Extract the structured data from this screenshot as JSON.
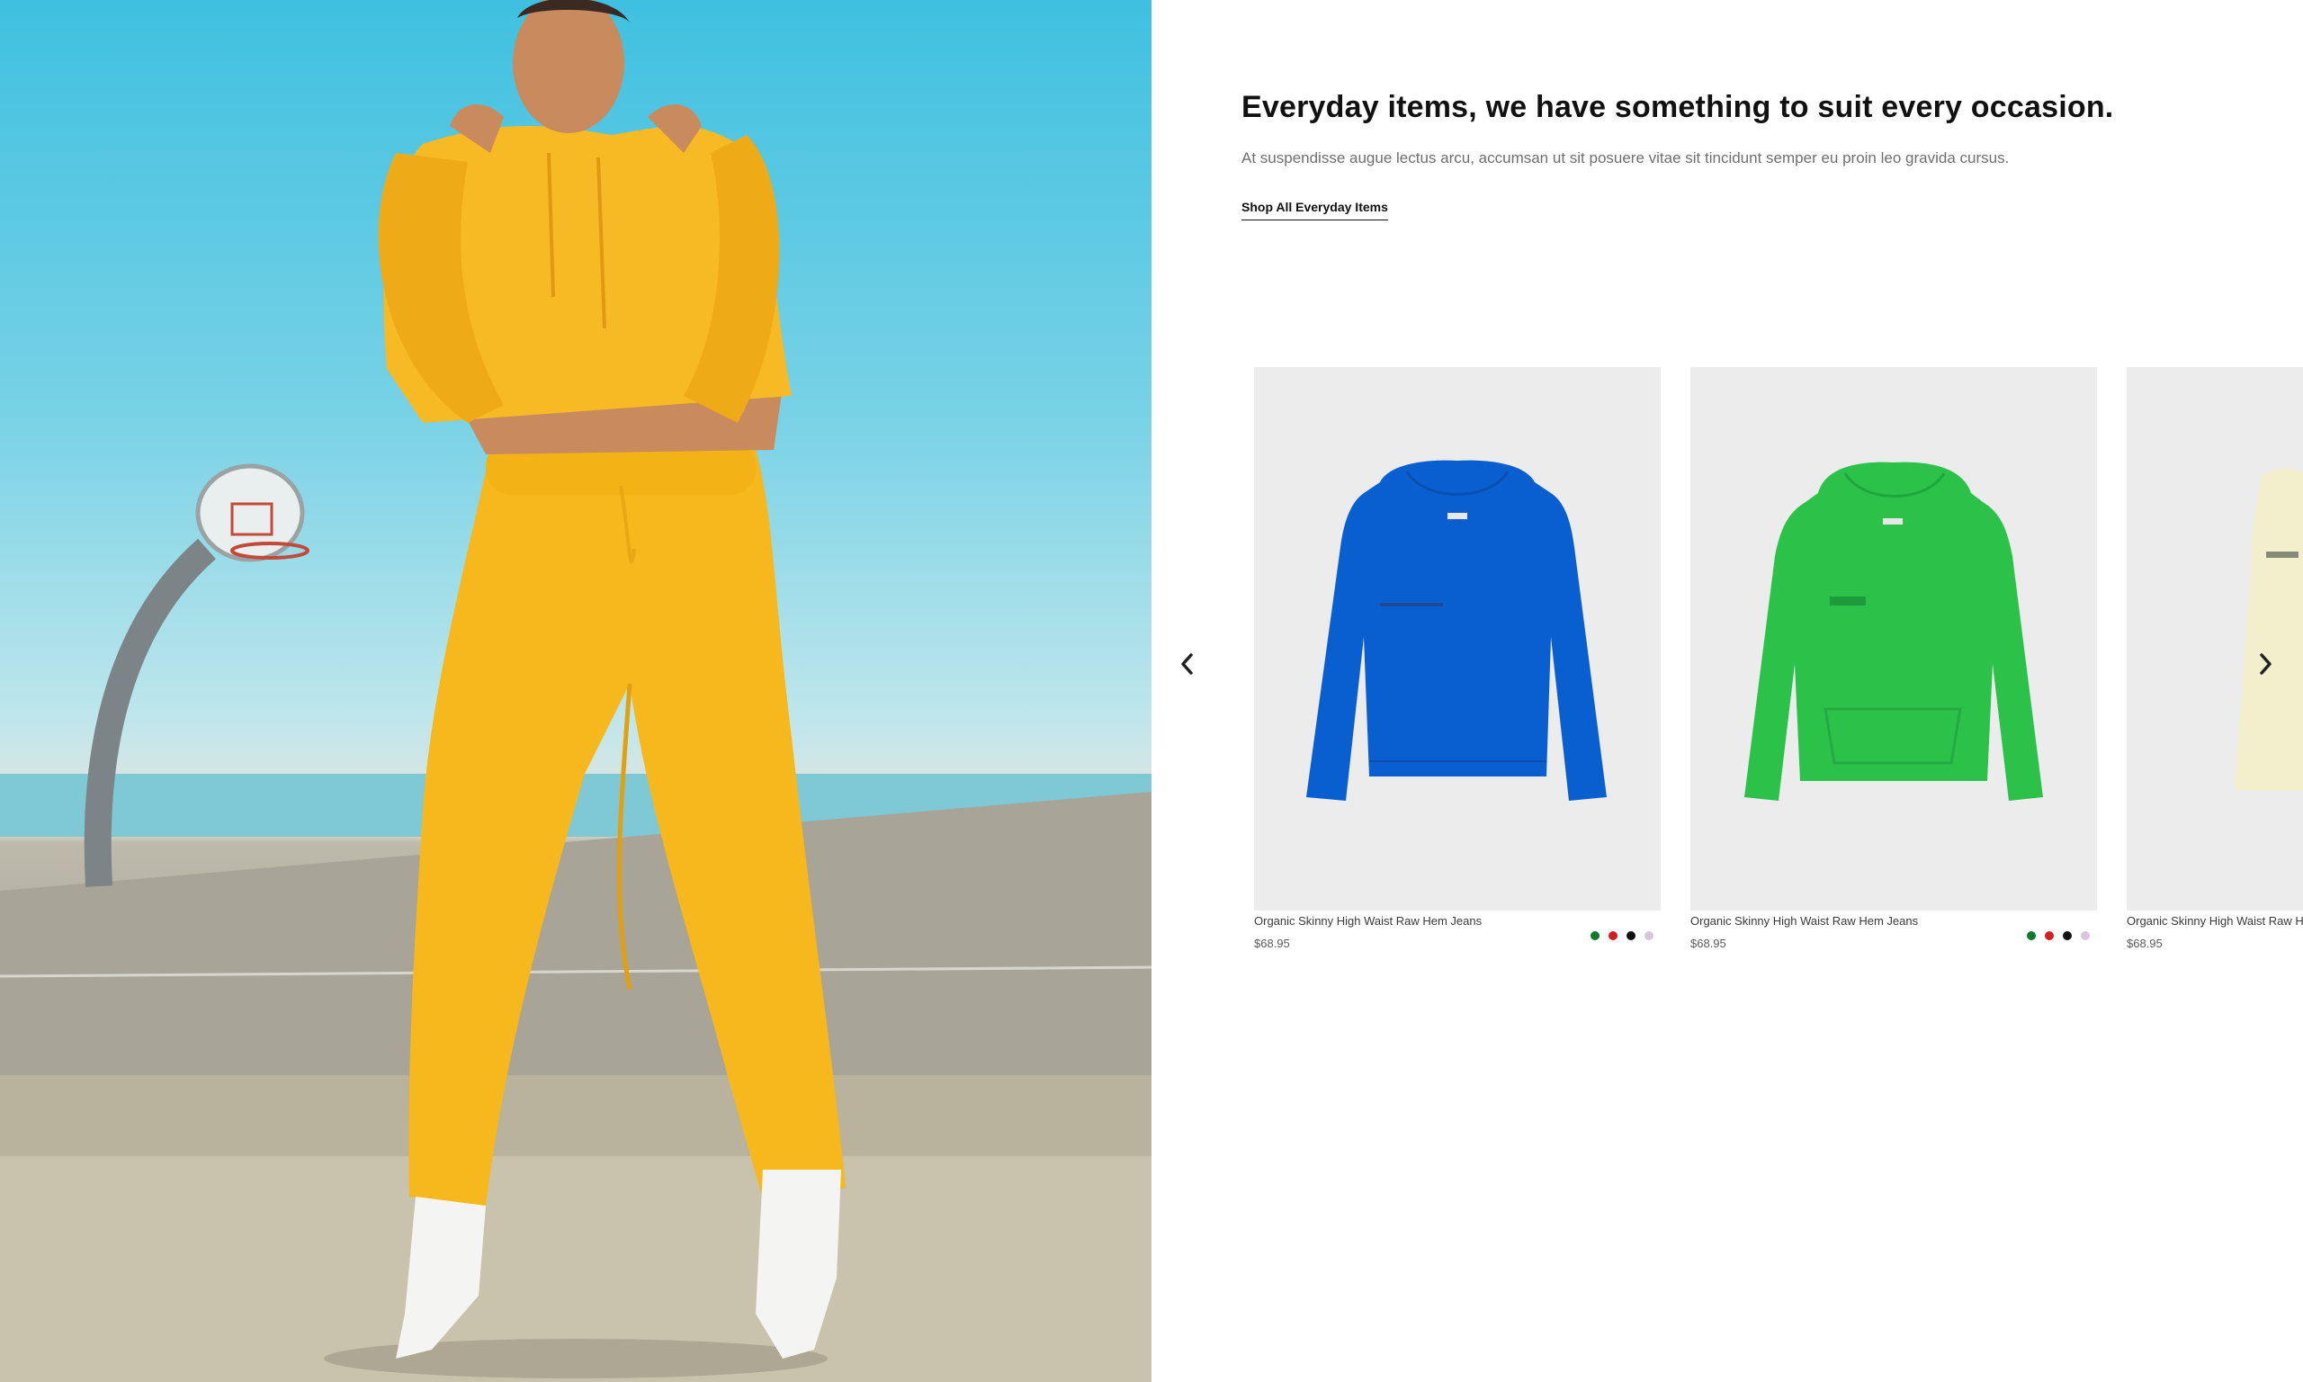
{
  "hero": {
    "image_alt": "Model in yellow cropped hoodie and jogger set standing on a basketball court by the sea",
    "colors": {
      "sky": "#3fc0e0",
      "outfit": "#f6b81c",
      "court": "#aaa69a"
    }
  },
  "section": {
    "headline": "Everyday items, we have something to suit every occasion.",
    "subtext": "At suspendisse augue lectus arcu, accumsan ut sit posuere vitae sit tincidunt semper eu proin leo gravida cursus.",
    "cta_label": "Shop All Everyday Items"
  },
  "carousel": {
    "prev_icon": "chevron-left-icon",
    "next_icon": "chevron-right-icon",
    "products": [
      {
        "name": "Organic Skinny High Waist Raw Hem Jeans",
        "price": "$68.95",
        "image_color": "#0a5fd0",
        "swatches": [
          "#0b7a2a",
          "#d0201f",
          "#111111",
          "#d8c6dc"
        ]
      },
      {
        "name": "Organic Skinny High Waist Raw Hem Jeans",
        "price": "$68.95",
        "image_color": "#2cc24a",
        "swatches": [
          "#0b7a2a",
          "#d0201f",
          "#111111",
          "#d8c6dc"
        ]
      },
      {
        "name": "Organic Skinny High Waist Raw Hem Jeans",
        "price": "$68.95",
        "image_color": "#f3eecb",
        "swatches": []
      }
    ]
  }
}
